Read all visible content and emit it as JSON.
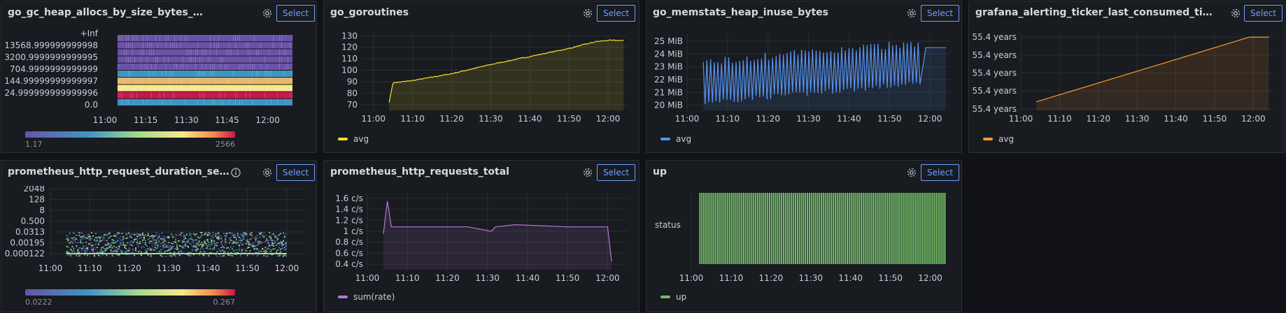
{
  "panels": {
    "p1": {
      "title": "go_gc_heap_allocs_by_size_bytes_bucket",
      "y_ticks": [
        "+Inf",
        "13568.999999999998",
        "3200.9999999999995",
        "704.9999999999999",
        "144.99999999999997",
        "24.999999999999996",
        "0.0"
      ],
      "x_ticks": [
        "11:00",
        "11:15",
        "11:30",
        "11:45",
        "12:00"
      ],
      "scale_min": "1.17",
      "scale_max": "2566"
    },
    "p2": {
      "title": "go_goroutines",
      "legend": "avg"
    },
    "p3": {
      "title": "go_memstats_heap_inuse_bytes",
      "legend": "avg"
    },
    "p4": {
      "title": "grafana_alerting_ticker_last_consumed_tick_tim...",
      "legend": "avg"
    },
    "p5": {
      "title": "prometheus_http_request_duration_seconds",
      "y_ticks": [
        "2048",
        "128",
        "8",
        "0.500",
        "0.0313",
        "0.00195",
        "0.000122"
      ],
      "x_ticks": [
        "11:00",
        "11:10",
        "11:20",
        "11:30",
        "11:40",
        "11:50",
        "12:00"
      ],
      "scale_min": "0.0222",
      "scale_max": "0.267"
    },
    "p6": {
      "title": "prometheus_http_requests_total",
      "legend": "sum(rate)"
    },
    "p7": {
      "title": "up",
      "row_label": "status",
      "legend": "up"
    }
  },
  "select_label": "Select",
  "icons": {
    "settings": "gear-icon",
    "info": "info-icon"
  },
  "colors": {
    "yellow": "#fade2a",
    "blue": "#5794f2",
    "orange": "#ff9830",
    "purple": "#b877d9",
    "green": "#73bf69"
  },
  "chart_data": [
    {
      "type": "heatmap",
      "title": "go_gc_heap_allocs_by_size_bytes_bucket",
      "y_buckets": [
        "0.0",
        "24.999999999999996",
        "144.99999999999997",
        "704.9999999999999",
        "3200.9999999999995",
        "13568.999999999998",
        "+Inf"
      ],
      "x_range": [
        "11:00",
        "12:00"
      ],
      "color_range": [
        1.17,
        2566
      ]
    },
    {
      "type": "line",
      "title": "go_goroutines",
      "series": [
        {
          "name": "avg",
          "x": [
            "11:04",
            "11:05",
            "11:10",
            "11:20",
            "11:30",
            "11:40",
            "11:50",
            "11:57",
            "12:00",
            "12:04"
          ],
          "values": [
            72,
            89,
            91,
            97,
            105,
            112,
            119,
            125,
            126,
            126
          ]
        }
      ],
      "x_ticks": [
        "11:00",
        "11:10",
        "11:20",
        "11:30",
        "11:40",
        "11:50",
        "12:00"
      ],
      "y_ticks": [
        70,
        80,
        90,
        100,
        110,
        120,
        130
      ],
      "ylim": [
        65,
        132
      ]
    },
    {
      "type": "line",
      "title": "go_memstats_heap_inuse_bytes",
      "y_unit": "MiB",
      "series": [
        {
          "name": "avg",
          "x": [
            "11:04",
            "11:20",
            "11:40",
            "11:58",
            "12:00",
            "12:04"
          ],
          "low": [
            20.2,
            20.8,
            21.3,
            21.7,
            24.5,
            24.5
          ],
          "high": [
            23.5,
            24.0,
            24.5,
            25.1,
            24.5,
            24.5
          ]
        }
      ],
      "x_ticks": [
        "11:00",
        "11:10",
        "11:20",
        "11:30",
        "11:40",
        "11:50",
        "12:00"
      ],
      "y_ticks": [
        "20 MiB",
        "21 MiB",
        "22 MiB",
        "23 MiB",
        "24 MiB",
        "25 MiB"
      ],
      "ylim": [
        19.6,
        25.6
      ]
    },
    {
      "type": "line",
      "title": "grafana_alerting_ticker_last_consumed_tick_time",
      "series": [
        {
          "name": "avg",
          "x": [
            "11:04",
            "11:59",
            "12:04"
          ],
          "values": [
            0.1,
            1.0,
            1.0
          ]
        }
      ],
      "x_ticks": [
        "11:00",
        "11:10",
        "11:20",
        "11:30",
        "11:40",
        "11:50",
        "12:00"
      ],
      "y_ticks": [
        "55.4 years",
        "55.4 years",
        "55.4 years",
        "55.4 years",
        "55.4 years"
      ]
    },
    {
      "type": "heatmap",
      "title": "prometheus_http_request_duration_seconds",
      "y_buckets": [
        "0.000122",
        "0.00195",
        "0.0313",
        "0.500",
        "8",
        "128",
        "2048"
      ],
      "x_range": [
        "11:00",
        "12:00"
      ],
      "color_range": [
        0.0222,
        0.267
      ]
    },
    {
      "type": "line",
      "title": "prometheus_http_requests_total",
      "y_unit": "c/s",
      "series": [
        {
          "name": "sum(rate)",
          "x": [
            "11:04",
            "11:05",
            "11:06",
            "11:25",
            "11:31",
            "11:32",
            "11:37",
            "11:50",
            "12:00",
            "12:01"
          ],
          "values": [
            0.95,
            1.55,
            1.08,
            1.08,
            1.0,
            1.08,
            1.12,
            1.08,
            1.08,
            0.45
          ]
        }
      ],
      "x_ticks": [
        "11:00",
        "11:10",
        "11:20",
        "11:30",
        "11:40",
        "11:50",
        "12:00"
      ],
      "y_ticks": [
        "0.4 c/s",
        "0.6 c/s",
        "0.8 c/s",
        "1 c/s",
        "1.2 c/s",
        "1.4 c/s",
        "1.6 c/s"
      ],
      "ylim": [
        0.3,
        1.7
      ]
    },
    {
      "type": "bar",
      "title": "up",
      "series": [
        {
          "name": "up",
          "values_constant": 1
        }
      ],
      "x_ticks": [
        "11:00",
        "11:10",
        "11:20",
        "11:30",
        "11:40",
        "11:50",
        "12:00"
      ],
      "row_label": "status"
    }
  ]
}
